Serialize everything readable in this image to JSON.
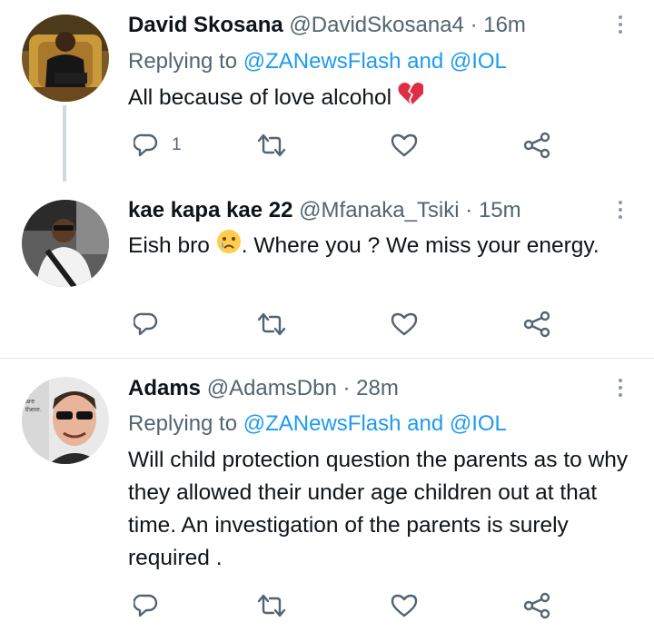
{
  "tweets": [
    {
      "name": "David Skosana",
      "handle": "@DavidSkosana4",
      "dot": "·",
      "time": "16m",
      "replying_prefix": "Replying to",
      "replying_to": "@ZANewsFlash and @IOL",
      "text": "All because of love alcohol",
      "emoji": "broken-heart",
      "reply_count": "1"
    },
    {
      "name": "kae kapa kae 22",
      "handle": "@Mfanaka_Tsiki",
      "dot": "·",
      "time": "15m",
      "text_before": "Eish bro",
      "emoji": "crying-face",
      "text_after": ".  Where you ? We miss your energy."
    },
    {
      "name": "Adams",
      "handle": "@AdamsDbn",
      "dot": "·",
      "time": "28m",
      "replying_prefix": "Replying to",
      "replying_to": "@ZANewsFlash and @IOL",
      "text": "Will child protection question the parents as to why they allowed their under age children out at that time. An investigation of the parents is surely required .",
      "avatar_text_lines": [
        "at",
        "are",
        "there."
      ]
    }
  ],
  "colors": {
    "text": "#0f1419",
    "muted": "#536471",
    "link": "#1d9bf0",
    "thread_line": "#cfd9de",
    "divider": "#e1e8ed"
  },
  "icons": [
    "reply-icon",
    "retweet-icon",
    "like-icon",
    "share-icon",
    "more-icon"
  ]
}
